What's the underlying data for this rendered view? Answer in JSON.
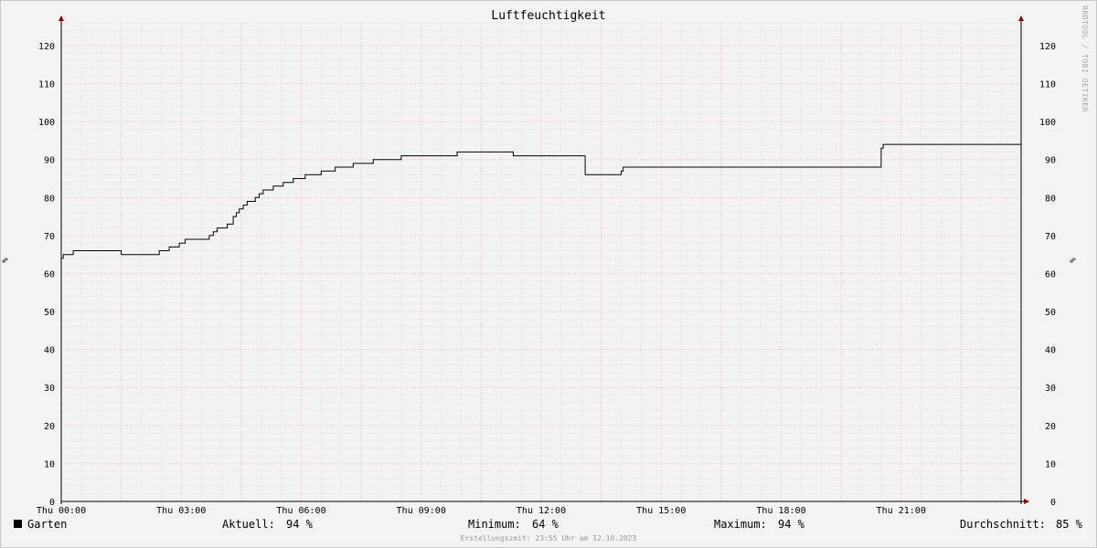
{
  "chart_data": {
    "type": "line",
    "title": "Luftfeuchtigkeit",
    "ylabel": "%",
    "ylim": [
      0,
      126
    ],
    "xlim": [
      0,
      24
    ],
    "y_ticks": [
      0,
      10,
      20,
      30,
      40,
      50,
      60,
      70,
      80,
      90,
      100,
      110,
      120
    ],
    "x_ticks": [
      {
        "value": 0,
        "label": "Thu 00:00"
      },
      {
        "value": 3,
        "label": "Thu 03:00"
      },
      {
        "value": 6,
        "label": "Thu 06:00"
      },
      {
        "value": 9,
        "label": "Thu 09:00"
      },
      {
        "value": 12,
        "label": "Thu 12:00"
      },
      {
        "value": 15,
        "label": "Thu 15:00"
      },
      {
        "value": 18,
        "label": "Thu 18:00"
      },
      {
        "value": 21,
        "label": "Thu 21:00"
      }
    ],
    "grid": true,
    "series": [
      {
        "name": "Garten",
        "color": "#000000",
        "points": [
          [
            0.0,
            64
          ],
          [
            0.05,
            65
          ],
          [
            0.3,
            66
          ],
          [
            1.5,
            65
          ],
          [
            2.45,
            66
          ],
          [
            2.7,
            67
          ],
          [
            2.95,
            68
          ],
          [
            3.1,
            69
          ],
          [
            3.7,
            70
          ],
          [
            3.8,
            71
          ],
          [
            3.9,
            72
          ],
          [
            4.15,
            73
          ],
          [
            4.3,
            75
          ],
          [
            4.38,
            76
          ],
          [
            4.45,
            77
          ],
          [
            4.55,
            78
          ],
          [
            4.65,
            79
          ],
          [
            4.85,
            80
          ],
          [
            4.95,
            81
          ],
          [
            5.05,
            82
          ],
          [
            5.3,
            83
          ],
          [
            5.55,
            84
          ],
          [
            5.8,
            85
          ],
          [
            6.1,
            86
          ],
          [
            6.5,
            87
          ],
          [
            6.85,
            88
          ],
          [
            7.3,
            89
          ],
          [
            7.8,
            90
          ],
          [
            8.5,
            91
          ],
          [
            9.9,
            92
          ],
          [
            11.3,
            91
          ],
          [
            13.1,
            86
          ],
          [
            14.0,
            87
          ],
          [
            14.05,
            88
          ],
          [
            20.5,
            93
          ],
          [
            20.55,
            94
          ],
          [
            24.0,
            94
          ]
        ]
      }
    ]
  },
  "legend": {
    "series_name": "Garten",
    "current_label": "Aktuell:",
    "current_value": "94 %",
    "min_label": "Minimum:",
    "min_value": "64 %",
    "max_label": "Maximum:",
    "max_value": "94 %",
    "avg_label": "Durchschnitt:",
    "avg_value": "85 %"
  },
  "watermark": "RRDTOOL / TOBI OETIKER",
  "created": "Erstellungszeit: 23:55 Uhr am 12.10.2023"
}
